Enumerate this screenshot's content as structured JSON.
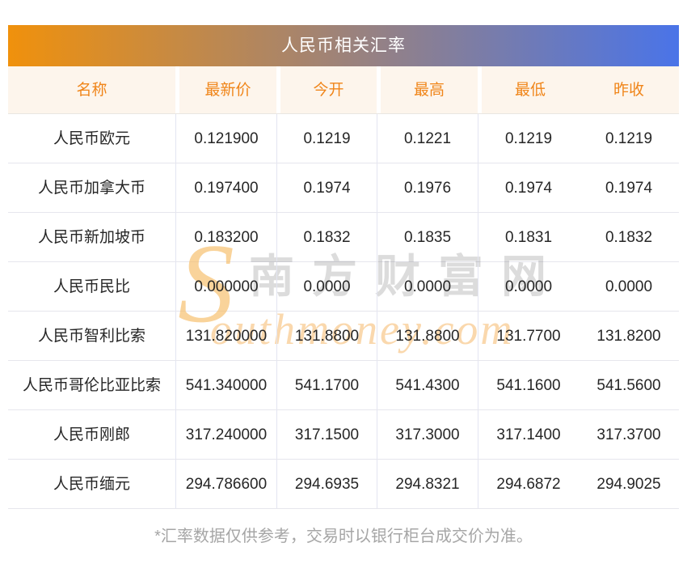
{
  "title": "人民币相关汇率",
  "columns": [
    "名称",
    "最新价",
    "今开",
    "最高",
    "最低",
    "昨收"
  ],
  "rows": [
    {
      "name": "人民币欧元",
      "latest": "0.121900",
      "open": "0.1219",
      "high": "0.1221",
      "low": "0.1219",
      "prev": "0.1219"
    },
    {
      "name": "人民币加拿大币",
      "latest": "0.197400",
      "open": "0.1974",
      "high": "0.1976",
      "low": "0.1974",
      "prev": "0.1974"
    },
    {
      "name": "人民币新加坡币",
      "latest": "0.183200",
      "open": "0.1832",
      "high": "0.1835",
      "low": "0.1831",
      "prev": "0.1832"
    },
    {
      "name": "人民币民比",
      "latest": "0.000000",
      "open": "0.0000",
      "high": "0.0000",
      "low": "0.0000",
      "prev": "0.0000"
    },
    {
      "name": "人民币智利比索",
      "latest": "131.820000",
      "open": "131.8800",
      "high": "131.8800",
      "low": "131.7700",
      "prev": "131.8200"
    },
    {
      "name": "人民币哥伦比亚比索",
      "latest": "541.340000",
      "open": "541.1700",
      "high": "541.4300",
      "low": "541.1600",
      "prev": "541.5600"
    },
    {
      "name": "人民币刚郎",
      "latest": "317.240000",
      "open": "317.1500",
      "high": "317.3000",
      "low": "317.1400",
      "prev": "317.3700"
    },
    {
      "name": "人民币缅元",
      "latest": "294.786600",
      "open": "294.6935",
      "high": "294.8321",
      "low": "294.6872",
      "prev": "294.9025"
    }
  ],
  "watermark": {
    "s": "S",
    "cn": "南方财富网",
    "en": "outhmoney.com"
  },
  "footer": "*汇率数据仅供参考，交易时以银行柜台成交价为准。",
  "colors": {
    "bar_gradient_left": "#f0910c",
    "bar_gradient_right": "#4a74e8",
    "header_bg": "#fdf5ec",
    "header_text": "#f08519",
    "cell_text": "#262626",
    "row_line": "#e6e6ed",
    "col_line": "#e3e5f1",
    "footer_text": "#a6a6a6",
    "watermark_orange": "#f4a23c"
  }
}
